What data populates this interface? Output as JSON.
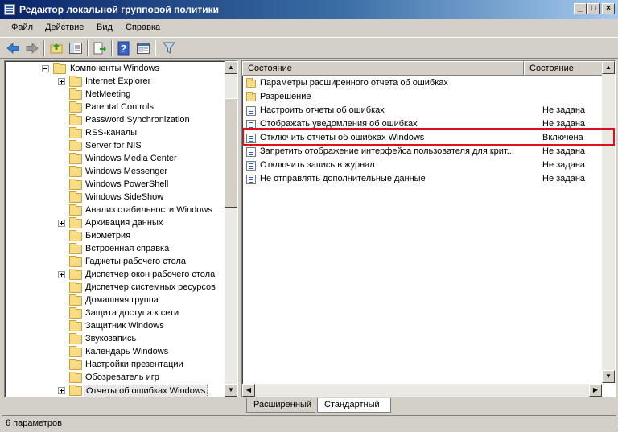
{
  "window": {
    "title": "Редактор локальной групповой политики"
  },
  "menu": {
    "items": [
      {
        "label": "Файл",
        "key": "Ф",
        "rest": "айл"
      },
      {
        "label": "Действие",
        "key": "Д",
        "rest": "ействие"
      },
      {
        "label": "Вид",
        "key": "В",
        "rest": "ид"
      },
      {
        "label": "Справка",
        "key": "С",
        "rest": "правка"
      }
    ]
  },
  "tree": {
    "root": "Компоненты Windows",
    "items": [
      {
        "label": "Internet Explorer",
        "expandable": true
      },
      {
        "label": "NetMeeting",
        "expandable": false
      },
      {
        "label": "Parental Controls",
        "expandable": false
      },
      {
        "label": "Password Synchronization",
        "expandable": false
      },
      {
        "label": "RSS-каналы",
        "expandable": false
      },
      {
        "label": "Server for NIS",
        "expandable": false
      },
      {
        "label": "Windows Media Center",
        "expandable": false
      },
      {
        "label": "Windows Messenger",
        "expandable": false
      },
      {
        "label": "Windows PowerShell",
        "expandable": false
      },
      {
        "label": "Windows SideShow",
        "expandable": false
      },
      {
        "label": "Анализ стабильности Windows",
        "expandable": false
      },
      {
        "label": "Архивация данных",
        "expandable": true
      },
      {
        "label": "Биометрия",
        "expandable": false
      },
      {
        "label": "Встроенная справка",
        "expandable": false
      },
      {
        "label": "Гаджеты рабочего стола",
        "expandable": false
      },
      {
        "label": "Диспетчер окон рабочего стола",
        "expandable": true
      },
      {
        "label": "Диспетчер системных ресурсов",
        "expandable": false
      },
      {
        "label": "Домашняя группа",
        "expandable": false
      },
      {
        "label": "Защита доступа к сети",
        "expandable": false
      },
      {
        "label": "Защитник Windows",
        "expandable": false
      },
      {
        "label": "Звукозапись",
        "expandable": false
      },
      {
        "label": "Календарь Windows",
        "expandable": false
      },
      {
        "label": "Настройки презентации",
        "expandable": false
      },
      {
        "label": "Обозреватель игр",
        "expandable": false
      },
      {
        "label": "Отчеты об ошибках Windows",
        "expandable": true,
        "selected": true
      }
    ]
  },
  "list": {
    "columns": {
      "name": "Состояние",
      "state": "Состояние"
    },
    "rows": [
      {
        "type": "folder",
        "name": "Параметры расширенного отчета об ошибках",
        "state": ""
      },
      {
        "type": "folder",
        "name": "Разрешение",
        "state": ""
      },
      {
        "type": "setting",
        "name": "Настроить отчеты об ошибках",
        "state": "Не задана"
      },
      {
        "type": "setting",
        "name": "Отображать уведомления об ошибках",
        "state": "Не задана"
      },
      {
        "type": "setting",
        "name": "Отключить отчеты об ошибках Windows",
        "state": "Включена",
        "highlighted": true
      },
      {
        "type": "setting",
        "name": "Запретить отображение интерфейса пользователя для крит...",
        "state": "Не задана"
      },
      {
        "type": "setting",
        "name": "Отключить запись в журнал",
        "state": "Не задана"
      },
      {
        "type": "setting",
        "name": "Не отправлять дополнительные данные",
        "state": "Не задана"
      }
    ]
  },
  "tabs": {
    "extended": "Расширенный",
    "standard": "Стандартный",
    "active": "standard"
  },
  "status": {
    "text": "6 параметров"
  },
  "colors": {
    "highlight_border": "#e0101a",
    "title_start": "#0a246a",
    "title_end": "#a6caf0"
  }
}
